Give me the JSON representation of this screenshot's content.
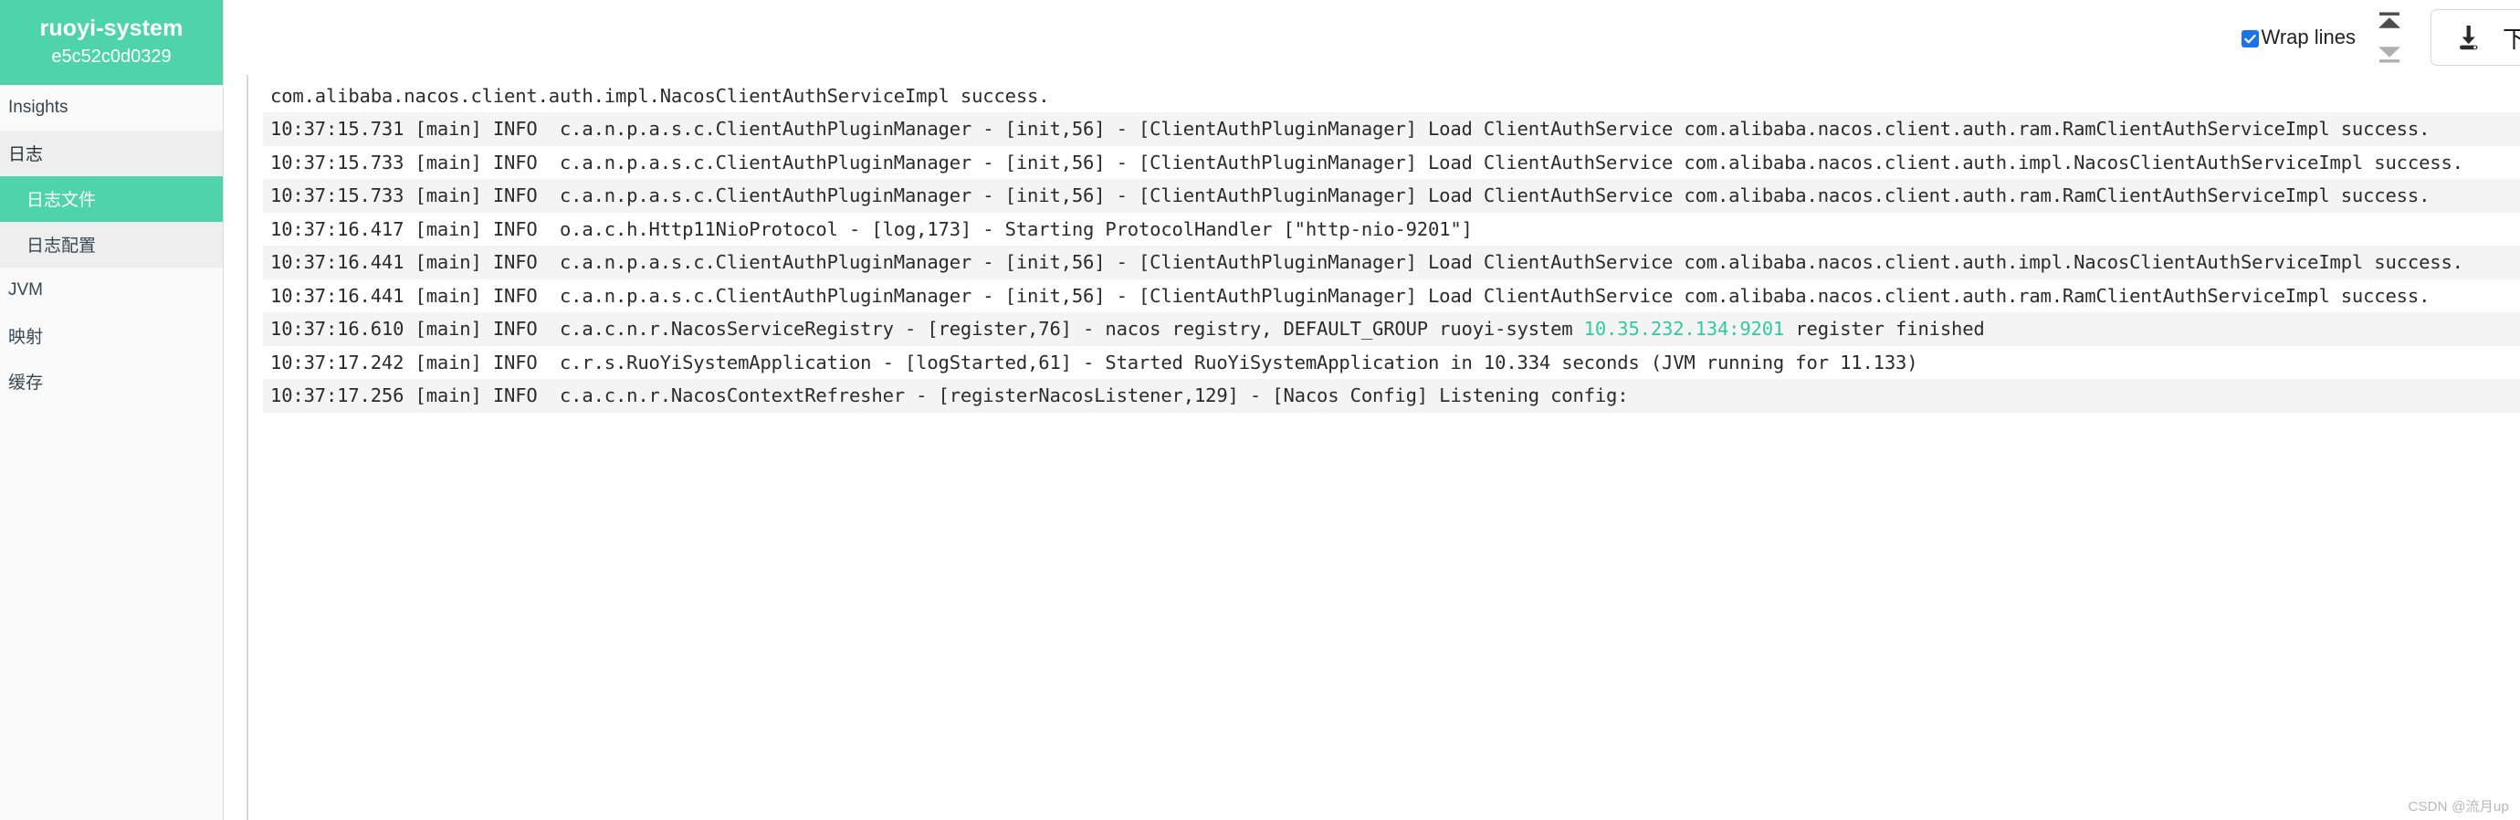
{
  "sidebar": {
    "app_title": "ruoyi-system",
    "instance_id": "e5c52c0d0329",
    "items": [
      {
        "label": "Insights",
        "level": 1,
        "state": "plain"
      },
      {
        "label": "日志",
        "level": 1,
        "state": "group"
      },
      {
        "label": "日志文件",
        "level": 2,
        "state": "selected"
      },
      {
        "label": "日志配置",
        "level": 2,
        "state": "subtle"
      },
      {
        "label": "JVM",
        "level": 1,
        "state": "plain"
      },
      {
        "label": "映射",
        "level": 1,
        "state": "plain"
      },
      {
        "label": "缓存",
        "level": 1,
        "state": "plain"
      }
    ]
  },
  "toolbar": {
    "wrap_lines_label": "Wrap lines",
    "wrap_lines_checked": true,
    "scroll_top_icon": "scroll-to-top-icon",
    "scroll_bottom_icon": "scroll-to-bottom-icon",
    "download_label": "下载",
    "download_icon": "download-icon"
  },
  "log": {
    "lines": [
      {
        "text": "10:37:15.731 [main] INFO  c.a.n.p.a.s.c.ClientAuthPluginManager - [init,56] - [ClientAuthPluginManager] Load ClientAuthService",
        "partial_top": true,
        "alt": false
      },
      {
        "text": "com.alibaba.nacos.client.auth.impl.NacosClientAuthServiceImpl success.",
        "alt": false
      },
      {
        "text": "10:37:15.731 [main] INFO  c.a.n.p.a.s.c.ClientAuthPluginManager - [init,56] - [ClientAuthPluginManager] Load ClientAuthService com.alibaba.nacos.client.auth.ram.RamClientAuthServiceImpl success.",
        "alt": true
      },
      {
        "text": "10:37:15.733 [main] INFO  c.a.n.p.a.s.c.ClientAuthPluginManager - [init,56] - [ClientAuthPluginManager] Load ClientAuthService com.alibaba.nacos.client.auth.impl.NacosClientAuthServiceImpl success.",
        "alt": false
      },
      {
        "text": "10:37:15.733 [main] INFO  c.a.n.p.a.s.c.ClientAuthPluginManager - [init,56] - [ClientAuthPluginManager] Load ClientAuthService com.alibaba.nacos.client.auth.ram.RamClientAuthServiceImpl success.",
        "alt": true
      },
      {
        "text": "10:37:16.417 [main] INFO  o.a.c.h.Http11NioProtocol - [log,173] - Starting ProtocolHandler [\"http-nio-9201\"]",
        "alt": false
      },
      {
        "text": "10:37:16.441 [main] INFO  c.a.n.p.a.s.c.ClientAuthPluginManager - [init,56] - [ClientAuthPluginManager] Load ClientAuthService com.alibaba.nacos.client.auth.impl.NacosClientAuthServiceImpl success.",
        "alt": true
      },
      {
        "text": "10:37:16.441 [main] INFO  c.a.n.p.a.s.c.ClientAuthPluginManager - [init,56] - [ClientAuthPluginManager] Load ClientAuthService com.alibaba.nacos.client.auth.ram.RamClientAuthServiceImpl success.",
        "alt": false
      },
      {
        "prefix": "10:37:16.610 [main] INFO  c.a.c.n.r.NacosServiceRegistry - [register,76] - nacos registry, DEFAULT_GROUP ruoyi-system ",
        "highlight": "10.35.232.134:9201",
        "suffix": " register finished",
        "alt": true
      },
      {
        "text": "10:37:17.242 [main] INFO  c.r.s.RuoYiSystemApplication - [logStarted,61] - Started RuoYiSystemApplication in 10.334 seconds (JVM running for 11.133)",
        "alt": false
      },
      {
        "text": "10:37:17.256 [main] INFO  c.a.c.n.r.NacosContextRefresher - [registerNacosListener,129] - [Nacos Config] Listening config:",
        "alt": true
      }
    ]
  },
  "watermark": "CSDN @流月up",
  "colors": {
    "brand_green": "#4ed4a8",
    "ip_highlight": "#2fcc9b",
    "checkbox_blue": "#1a73e8",
    "row_alt": "#f4f4f4"
  }
}
